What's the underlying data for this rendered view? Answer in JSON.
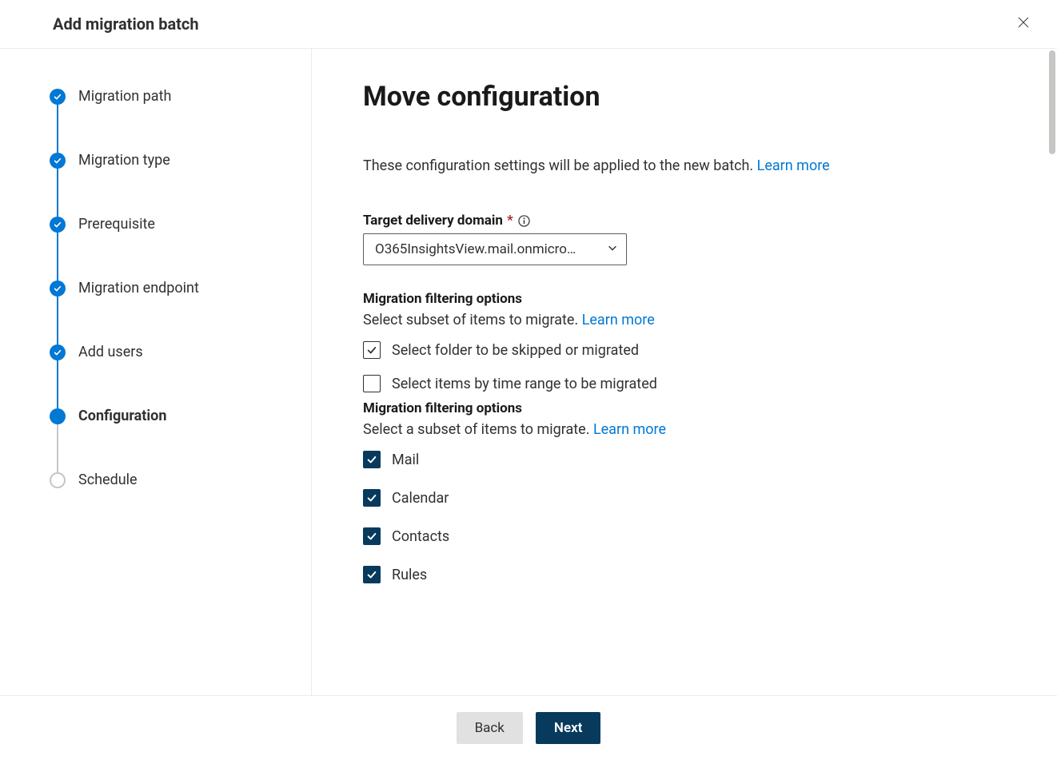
{
  "header": {
    "title": "Add migration batch"
  },
  "steps": [
    {
      "label": "Migration path",
      "state": "done"
    },
    {
      "label": "Migration type",
      "state": "done"
    },
    {
      "label": "Prerequisite",
      "state": "done"
    },
    {
      "label": "Migration endpoint",
      "state": "done"
    },
    {
      "label": "Add users",
      "state": "done"
    },
    {
      "label": "Configuration",
      "state": "current"
    },
    {
      "label": "Schedule",
      "state": "future"
    }
  ],
  "page": {
    "title": "Move configuration",
    "intro_text": "These configuration settings will be applied to the new batch. ",
    "intro_link": "Learn more"
  },
  "target_domain": {
    "label": "Target delivery domain",
    "required": true,
    "value": "O365InsightsView.mail.onmicro…"
  },
  "filter1": {
    "heading": "Migration filtering options",
    "sub": "Select subset of items to migrate. ",
    "learn_more": "Learn more",
    "opt_folder": {
      "label": "Select folder to be skipped or migrated",
      "checked": true
    },
    "opt_time": {
      "label": "Select items by time range to be migrated",
      "checked": false
    }
  },
  "filter2": {
    "heading": "Migration filtering options",
    "sub": "Select a subset of items to migrate. ",
    "learn_more": "Learn more",
    "items": [
      {
        "label": "Mail",
        "checked": true
      },
      {
        "label": "Calendar",
        "checked": true
      },
      {
        "label": "Contacts",
        "checked": true
      },
      {
        "label": "Rules",
        "checked": true
      }
    ]
  },
  "footer": {
    "back": "Back",
    "next": "Next"
  }
}
